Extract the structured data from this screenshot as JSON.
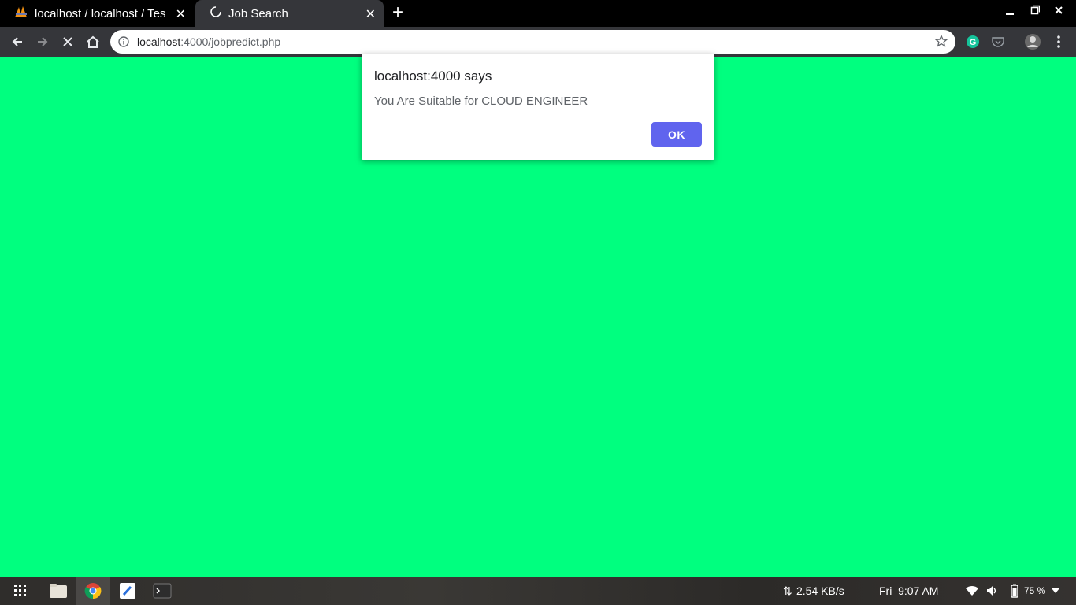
{
  "browser": {
    "tabs": [
      {
        "title": "localhost / localhost / Tes",
        "active": false
      },
      {
        "title": "Job Search",
        "active": true
      }
    ],
    "url_host": "localhost",
    "url_path": ":4000/jobpredict.php"
  },
  "dialog": {
    "heading": "localhost:4000 says",
    "message": "You Are Suitable for CLOUD ENGINEER",
    "ok_label": "OK"
  },
  "page": {
    "background": "#00ff7f"
  },
  "taskbar": {
    "network_speed": "2.54 KB/s",
    "clock": "Fri  9:07 AM",
    "battery": "75 %"
  }
}
